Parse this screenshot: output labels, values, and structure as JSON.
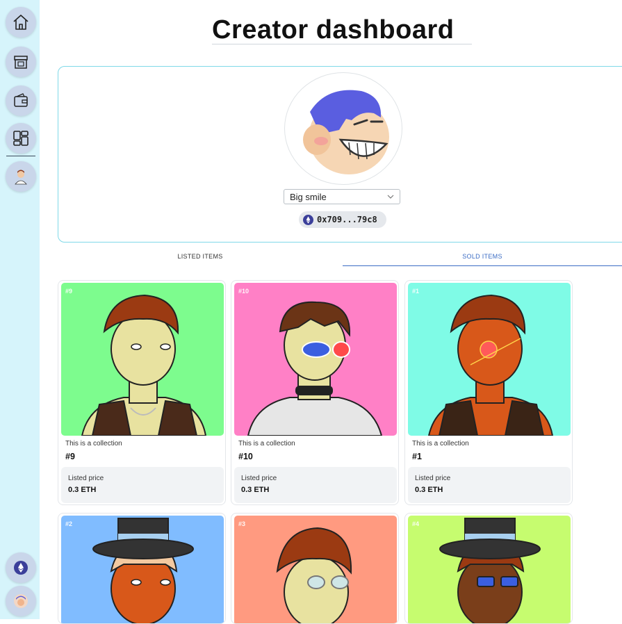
{
  "page": {
    "title": "Creator dashboard"
  },
  "sidebar": {
    "items": [
      {
        "name": "home",
        "icon": "home-icon"
      },
      {
        "name": "marketplace",
        "icon": "storefront-icon"
      },
      {
        "name": "wallet",
        "icon": "wallet-icon"
      },
      {
        "name": "dashboard",
        "icon": "dashboard-grid-icon"
      },
      {
        "name": "profile",
        "icon": "user-avatar-icon"
      }
    ],
    "bottom": [
      {
        "name": "network",
        "icon": "ethereum-icon"
      },
      {
        "name": "account",
        "icon": "account-avatar-icon"
      }
    ]
  },
  "profile": {
    "avatar_style_selected": "Big smile",
    "address": "0x709...79c8"
  },
  "tabs": [
    {
      "label": "LISTED ITEMS",
      "active": false
    },
    {
      "label": "SOLD ITEMS",
      "active": true
    }
  ],
  "items": [
    {
      "badge": "#9",
      "collection": "This is a collection",
      "name": "#9",
      "price_label": "Listed price",
      "price": "0.3 ETH",
      "bg": "#7dfc8e"
    },
    {
      "badge": "#10",
      "collection": "This is a collection",
      "name": "#10",
      "price_label": "Listed price",
      "price": "0.3 ETH",
      "bg": "#ff80c6"
    },
    {
      "badge": "#1",
      "collection": "This is a collection",
      "name": "#1",
      "price_label": "Listed price",
      "price": "0.3 ETH",
      "bg": "#7ffbe6"
    }
  ],
  "items_row2": [
    {
      "badge": "#2",
      "bg": "#80bcff"
    },
    {
      "badge": "#3",
      "bg": "#ff9a80"
    },
    {
      "badge": "#4",
      "bg": "#c6fc6f"
    }
  ],
  "colors": {
    "accent": "#3b6cc4",
    "sidebar_bg": "#d6f4fb",
    "card_border": "#7fd9e8"
  }
}
